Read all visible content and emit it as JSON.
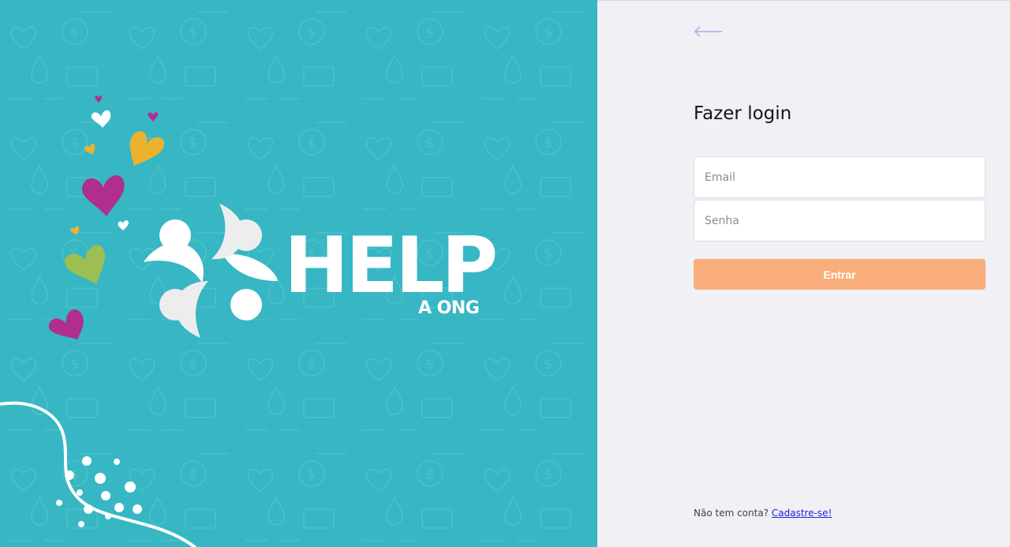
{
  "colors": {
    "left_background": "#37b6c3",
    "right_background": "#f0f0f5",
    "button_background": "#f9ae7b",
    "link_color": "#2323d9",
    "heart_magenta": "#b02e8c",
    "heart_yellow": "#ecb22e",
    "heart_green": "#9dbe50",
    "back_arrow_color": "#b7a6e8"
  },
  "brand": {
    "logo_word": "HELP",
    "logo_subtitle": "A ONG"
  },
  "login": {
    "back_icon": "arrow-left-icon",
    "title": "Fazer login",
    "email_placeholder": "Email",
    "password_placeholder": "Senha",
    "submit_label": "Entrar",
    "signup_prompt": "Não tem conta?",
    "signup_link": "Cadastre-se!"
  }
}
